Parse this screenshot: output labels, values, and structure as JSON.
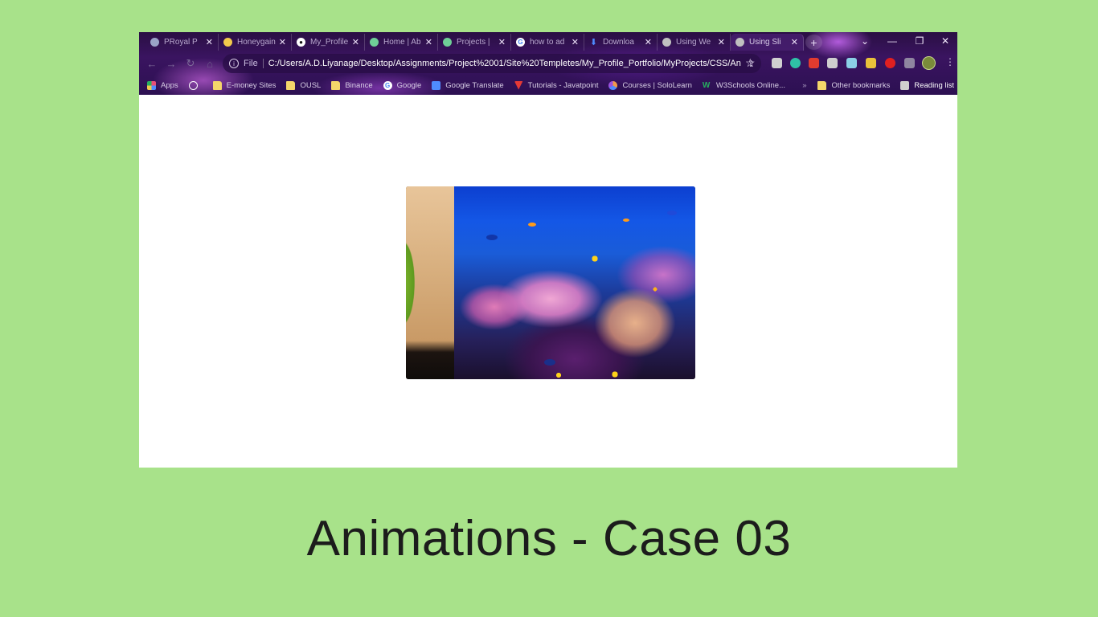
{
  "window": {
    "tabs": [
      {
        "title": "PRoyal P",
        "favicon": "royal-icon",
        "color": "#9aa3c7",
        "active": false
      },
      {
        "title": "Honeygain",
        "favicon": "honeygain-icon",
        "color": "#f2c94c",
        "active": false
      },
      {
        "title": "My_Profile",
        "favicon": "github-icon",
        "color": "#ffffff",
        "active": false
      },
      {
        "title": "Home | Ab",
        "favicon": "globe-icon",
        "color": "#6fcf97",
        "active": false
      },
      {
        "title": "Projects |",
        "favicon": "globe-icon",
        "color": "#6fcf97",
        "active": false
      },
      {
        "title": "how to ad",
        "favicon": "google-icon",
        "color": "#ffffff",
        "active": false
      },
      {
        "title": "Downloa",
        "favicon": "download-icon",
        "color": "#4f8cff",
        "active": false
      },
      {
        "title": "Using We",
        "favicon": "globe-icon",
        "color": "#c0c0c0",
        "active": false
      },
      {
        "title": "Using Sli",
        "favicon": "globe-icon",
        "color": "#c0c0c0",
        "active": true
      }
    ],
    "new_tab_label": "+",
    "controls": {
      "search_tabs": "⌄",
      "minimize": "—",
      "restore": "❐",
      "close": "✕"
    }
  },
  "toolbar": {
    "back": "←",
    "forward": "→",
    "reload": "↻",
    "scheme_label": "File",
    "url": "C:/Users/A.D.Liyanage/Desktop/Assignments/Project%2001/Site%20Templetes/My_Profile_Portfolio/MyProjects/CSS/Ani...",
    "share_icon": "⇪",
    "star_icon": "☆",
    "menu": "⋮"
  },
  "bookmarks": {
    "items": [
      {
        "label": "Apps",
        "icon": "apps-grid-icon",
        "color": "#e94e77"
      },
      {
        "label": "",
        "icon": "speedometer-icon",
        "color": "#ffffff"
      },
      {
        "label": "E-money Sites",
        "icon": "folder-icon",
        "color": "#f5d66a"
      },
      {
        "label": "OUSL",
        "icon": "folder-icon",
        "color": "#f5d66a"
      },
      {
        "label": "Binance",
        "icon": "folder-icon",
        "color": "#f5d66a"
      },
      {
        "label": "Google",
        "icon": "google-icon",
        "color": "#ffffff"
      },
      {
        "label": "Google Translate",
        "icon": "translate-icon",
        "color": "#4f8cff"
      },
      {
        "label": "Tutorials - Javatpoint",
        "icon": "javatpoint-icon",
        "color": "#e53935"
      },
      {
        "label": "Courses | SoloLearn",
        "icon": "sololearn-icon",
        "color": "#f2994a"
      },
      {
        "label": "W3Schools Online...",
        "icon": "w3schools-icon",
        "color": "#27ae60"
      }
    ],
    "overflow": "»",
    "other_bookmarks": "Other bookmarks",
    "reading_list": "Reading list"
  },
  "page": {
    "stage_images": [
      "parrot-image",
      "coral-reef-image"
    ]
  },
  "caption": "Animations - Case 03"
}
